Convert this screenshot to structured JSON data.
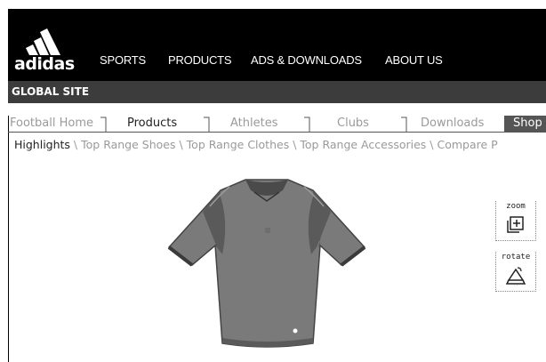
{
  "header": {
    "logo_text": "adidas",
    "nav": [
      {
        "label": "SPORTS"
      },
      {
        "label": "PRODUCTS"
      },
      {
        "label": "ADS & DOWNLOADS"
      },
      {
        "label": "ABOUT US"
      }
    ]
  },
  "global_bar": {
    "label": "GLOBAL SITE"
  },
  "tabs": [
    {
      "label": "Football Home",
      "active": false
    },
    {
      "label": "Products",
      "active": true
    },
    {
      "label": "Athletes",
      "active": false
    },
    {
      "label": "Clubs",
      "active": false
    },
    {
      "label": "Downloads",
      "active": false
    },
    {
      "label": "Shop",
      "active": false
    }
  ],
  "subnav": [
    {
      "label": "Highlights",
      "current": true
    },
    {
      "label": "Top Range Shoes",
      "current": false
    },
    {
      "label": "Top Range Clothes",
      "current": false
    },
    {
      "label": "Top Range Accessories",
      "current": false
    },
    {
      "label": "Compare P",
      "current": false
    }
  ],
  "subnav_separator": " \\ ",
  "tools": {
    "zoom_label": "zoom",
    "rotate_label": "rotate",
    "zoom_icon": "zoom-icon",
    "rotate_icon": "rotate-icon"
  },
  "colors": {
    "header_bg": "#000000",
    "global_bar_bg": "#3c3c3c",
    "inactive_text": "#9a9a9a",
    "shirt": "#7a7a7a"
  }
}
